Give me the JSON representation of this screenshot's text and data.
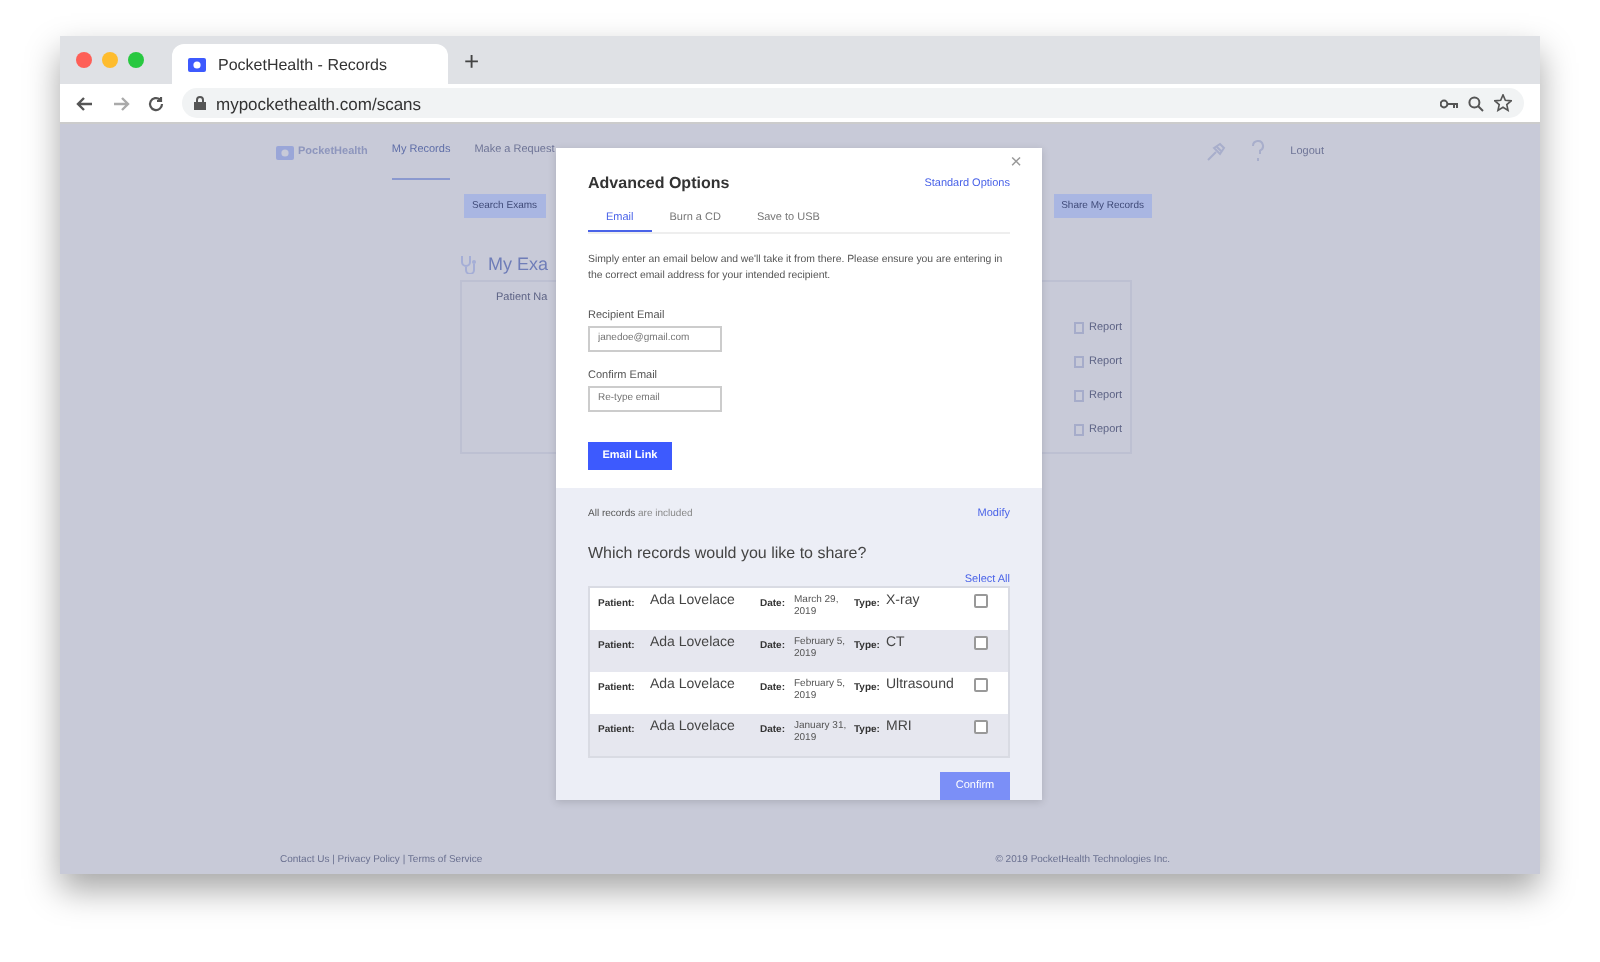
{
  "browser": {
    "tab_title": "PocketHealth - Records",
    "new_tab": "+",
    "url": "mypockethealth.com/scans"
  },
  "page": {
    "logo": "PocketHealth",
    "nav": [
      {
        "label": "My Records",
        "selected": true
      },
      {
        "label": "Make a Request",
        "selected": false
      }
    ],
    "logout": "Logout",
    "search_button": "Search Exams",
    "share_button": "Share My Records",
    "heading": "My Exa",
    "column_1": "Patient Na",
    "report_links": [
      "Report",
      "Report",
      "Report",
      "Report"
    ],
    "footer_links": "Contact Us | Privacy Policy | Terms of Service",
    "copyright": "© 2019 PocketHealth Technologies Inc."
  },
  "modal": {
    "title": "Advanced Options",
    "close": "×",
    "standard_options": "Standard Options",
    "tabs": [
      {
        "label": "Email",
        "selected": true
      },
      {
        "label": "Burn a CD",
        "selected": false
      },
      {
        "label": "Save to USB",
        "selected": false
      }
    ],
    "description": "Simply enter an email below and we'll take it from there. Please ensure you are entering in the correct email address for your intended recipient.",
    "recipient_label": "Recipient Email",
    "recipient_placeholder": "janedoe@gmail.com",
    "confirm_label": "Confirm Email",
    "confirm_placeholder": "Re-type email",
    "email_button": "Email Link",
    "included_note": "**All records** are included",
    "modify": "Modify",
    "question": "Which records would you like to share?",
    "select_all": "Select All",
    "records": [
      {
        "patient_label": "Patient:",
        "patient": "Ada Lovelace",
        "date_label": "Date:",
        "date": "March 29, 2019",
        "type_label": "Type:",
        "type": "X-ray",
        "checked": false
      },
      {
        "patient_label": "Patient:",
        "patient": "Ada Lovelace",
        "date_label": "Date:",
        "date": "February 5, 2019",
        "type_label": "Type:",
        "type": "CT",
        "checked": false
      },
      {
        "patient_label": "Patient:",
        "patient": "Ada Lovelace",
        "date_label": "Date:",
        "date": "February 5, 2019",
        "type_label": "Type:",
        "type": "Ultrasound",
        "checked": false
      },
      {
        "patient_label": "Patient:",
        "patient": "Ada Lovelace",
        "date_label": "Date:",
        "date": "January 31, 2019",
        "type_label": "Type:",
        "type": "MRI",
        "checked": false
      }
    ],
    "confirm_button": "Confirm"
  }
}
